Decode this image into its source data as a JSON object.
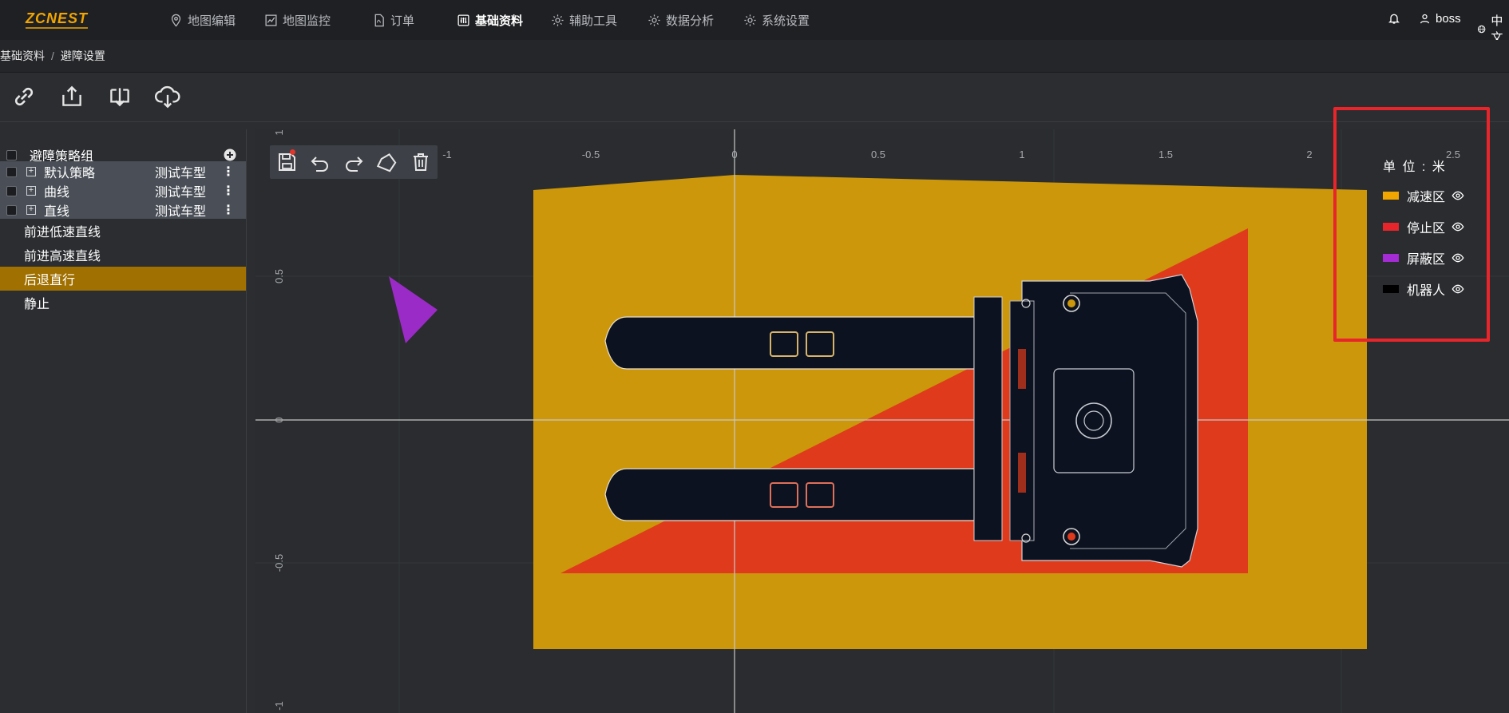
{
  "logo": "ZCNEST",
  "nav": {
    "items": [
      {
        "label": "地图编辑",
        "icon": "map-pin-icon"
      },
      {
        "label": "地图监控",
        "icon": "chart-icon"
      },
      {
        "label": "订单",
        "icon": "pdf-icon"
      },
      {
        "label": "基础资料",
        "icon": "sliders-icon"
      },
      {
        "label": "辅助工具",
        "icon": "gear-icon"
      },
      {
        "label": "数据分析",
        "icon": "gear-icon"
      },
      {
        "label": "系统设置",
        "icon": "gear-icon"
      }
    ],
    "active": "基础资料",
    "user": "boss",
    "lang": "中文"
  },
  "breadcrumb": {
    "root": "基础资料",
    "sep": "/",
    "current": "避障设置"
  },
  "toolbar": {
    "icons": [
      "link-icon",
      "upload-icon",
      "download-icon",
      "cloud-download-icon"
    ]
  },
  "sidebar": {
    "header": "避障策略组",
    "groups": [
      {
        "label": "默认策略",
        "vehicle": "测试车型"
      },
      {
        "label": "曲线",
        "vehicle": "测试车型"
      },
      {
        "label": "直线",
        "vehicle": "测试车型"
      }
    ],
    "items": [
      "前进低速直线",
      "前进高速直线",
      "后退直行",
      "静止"
    ],
    "selected": "后退直行"
  },
  "canvas": {
    "x_ticks": [
      "-1",
      "-0.5",
      "0",
      "0.5",
      "1",
      "1.5",
      "2",
      "2.5"
    ],
    "y_ticks": [
      "1",
      "0.5",
      "0",
      "-0.5",
      "-1"
    ]
  },
  "legend": {
    "unit": "单 位 : 米",
    "entries": [
      {
        "label": "减速区",
        "color": "#f0a500"
      },
      {
        "label": "停止区",
        "color": "#e8252b"
      },
      {
        "label": "屏蔽区",
        "color": "#a52bd4"
      },
      {
        "label": "机器人",
        "color": "#000000"
      }
    ]
  },
  "colors": {
    "slow_zone": "#cc970a",
    "stop_zone": "#df3a1c",
    "mask_zone": "#9b2bc6",
    "robot": "#0d1220",
    "accent": "#f0a500",
    "highlight_border": "#e8252b"
  }
}
